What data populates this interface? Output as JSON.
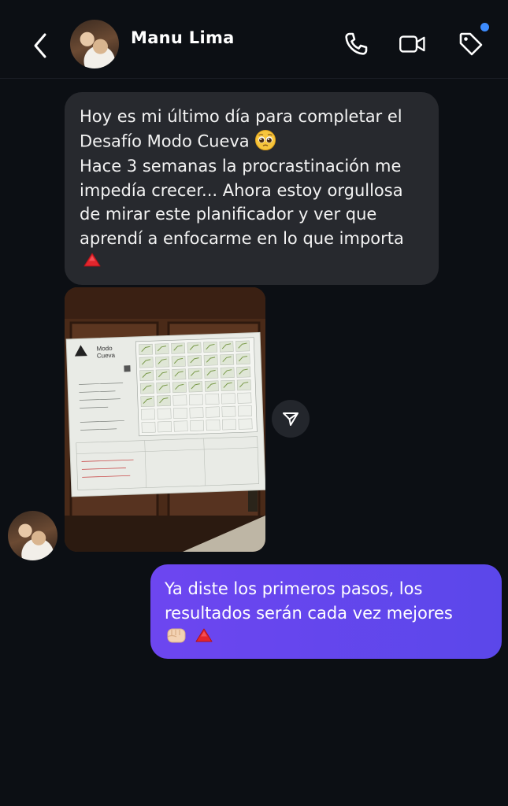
{
  "header": {
    "contact_name": "Manu Lima",
    "icons": [
      "back-chevron-icon",
      "phone-icon",
      "video-call-icon",
      "tag-icon"
    ],
    "notification_dot_color": "#3d8bfd"
  },
  "messages": {
    "incoming_text": {
      "lines": [
        "Hoy es mi último día para completar el",
        "Desafío Modo Cueva",
        "Hace 3 semanas la procrastinación me",
        "impedía crecer... Ahora estoy orgullosa",
        "de mirar este planificador y ver que",
        "aprendí a enfocarme en lo que importa"
      ],
      "emoji_after_line_2": "pleading-face-emoji",
      "emoji_last": "red-triangle-emoji"
    },
    "incoming_photo": {
      "poster_brand": "Modo\nCueva",
      "share_icon": "send-icon"
    },
    "outgoing_text": {
      "lines": [
        "Ya diste los primeros pasos, los",
        "resultados serán cada vez mejores"
      ],
      "emojis": [
        "fist-emoji",
        "red-triangle-emoji"
      ],
      "bubble_color": "#6246ee"
    }
  }
}
